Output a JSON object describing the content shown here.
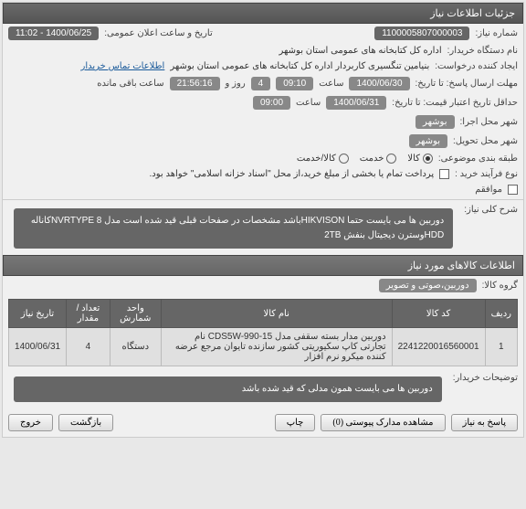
{
  "header": {
    "title": "جزئیات اطلاعات نیاز"
  },
  "fields": {
    "need_no_label": "شماره نیاز:",
    "need_no": "1100005807000003",
    "announce_label": "تاریخ و ساعت اعلان عمومی:",
    "announce_val": "1400/06/25 - 11:02",
    "buyer_label": "نام دستگاه خریدار:",
    "buyer_val": "اداره کل کتابخانه های عمومی استان بوشهر",
    "creator_label": "ایجاد کننده درخواست:",
    "creator_val": "بنیامین تنگسیری کاربردار اداره کل کتابخانه های عمومی استان بوشهر",
    "contact_link": "اطلاعات تماس خریدار",
    "deadline_label": "مهلت ارسال پاسخ: تا تاریخ:",
    "deadline_date": "1400/06/30",
    "deadline_time_label": "ساعت",
    "deadline_time": "09:10",
    "day_label": "روز و",
    "day_val": "4",
    "remain_time": "21:56:16",
    "remain_label": "ساعت باقی مانده",
    "validity_label": "حداقل تاریخ اعتبار قیمت: تا تاریخ:",
    "validity_date": "1400/06/31",
    "validity_time": "09:00",
    "exec_city_label": "شهر محل اجرا:",
    "exec_city": "بوشهر",
    "deliver_city_label": "شهر محل تحویل:",
    "deliver_city": "بوشهر",
    "category_label": "طبقه بندی موضوعی:",
    "cat_opt1": "کالا",
    "cat_opt2": "خدمت",
    "cat_opt3": "کالا/خدمت",
    "process_label": "نوع فرآیند خرید :",
    "process_note": "پرداخت تمام یا بخشی از مبلغ خرید،از محل \"اسناد خزانه اسلامی\" خواهد بود.",
    "agree_label": "موافقم",
    "main_desc_label": "شرح کلی نیاز:",
    "main_desc": "دوربین ها می بایست حتما HIKVISONباشد مشخصات در صفحات قبلی قید شده است  مدل NVRTYPE 8کاناله  HDDوسترن دیجیتال بنفش 2TB",
    "items_header": "اطلاعات کالاهای مورد نیاز",
    "group_label": "گروه کالا:",
    "group_val": "دوربین،صوتی و تصویر",
    "table": {
      "cols": [
        "ردیف",
        "کد کالا",
        "نام کالا",
        "واحد شمارش",
        "تعداد / مقدار",
        "تاریخ نیاز"
      ],
      "rows": [
        {
          "idx": "1",
          "code": "2241220016560001",
          "name": "دوربین مدار بسته سقفی مدل CDS5W-990-15 نام تجارتی کاپ سکیوریتی کشور سازنده تایوان مرجع عرضه کننده میکرو نرم افزار",
          "unit": "دستگاه",
          "qty": "4",
          "date": "1400/06/31"
        }
      ]
    },
    "notes_label": "توضیحات خریدار:",
    "notes_val": "دوربین ها می بایست همون مدلی که قید شده باشد"
  },
  "buttons": {
    "reply": "پاسخ به نیاز",
    "attachments": "مشاهده مدارک پیوستی (0)",
    "print": "چاپ",
    "back": "بازگشت",
    "exit": "خروج"
  }
}
